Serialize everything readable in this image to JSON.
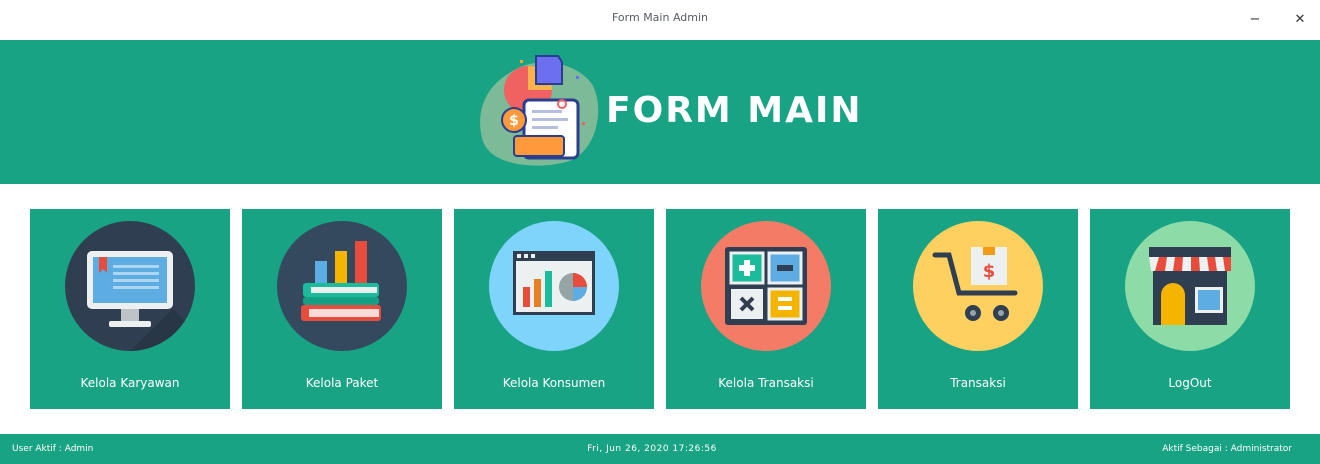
{
  "window": {
    "title": "Form Main Admin",
    "minimize_glyph": "−",
    "close_glyph": "✕"
  },
  "header": {
    "title": "FORM MAIN",
    "logo_icon": "invoice-document-icon"
  },
  "menu": {
    "items": [
      {
        "label": "Kelola Karyawan",
        "icon": "monitor-icon",
        "circle_color": "#2f3e50"
      },
      {
        "label": "Kelola Paket",
        "icon": "books-chart-icon",
        "circle_color": "#34495e"
      },
      {
        "label": "Kelola Konsumen",
        "icon": "analytics-window-icon",
        "circle_color": "#7fd4fb"
      },
      {
        "label": "Kelola Transaksi",
        "icon": "calculator-icon",
        "circle_color": "#f47c66"
      },
      {
        "label": "Transaksi",
        "icon": "shopping-cart-icon",
        "circle_color": "#fed05f"
      },
      {
        "label": "LogOut",
        "icon": "store-icon",
        "circle_color": "#8ddba7"
      }
    ]
  },
  "status": {
    "user": "User Aktif : Admin",
    "datetime": "Fri, Jun 26, 2020 17:26:56",
    "role": "Aktif Sebagai : Administrator"
  },
  "colors": {
    "accent": "#18a385",
    "background": "#ffffff"
  }
}
